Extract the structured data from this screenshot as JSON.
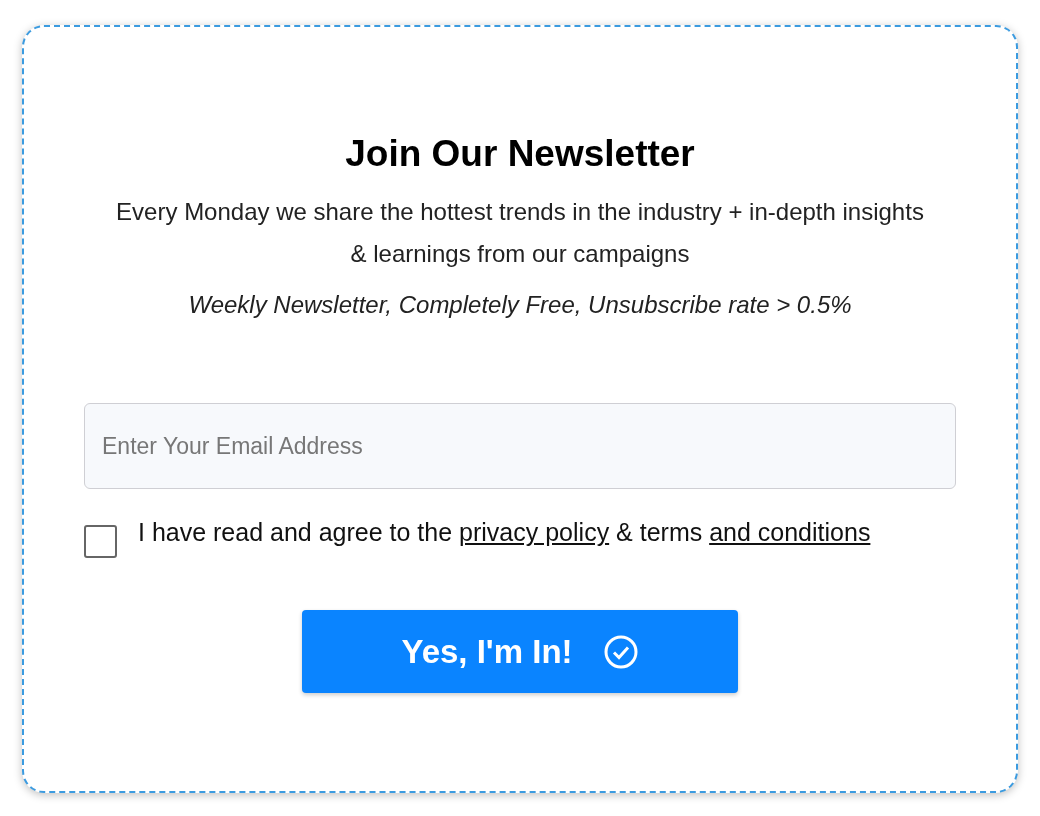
{
  "title": "Join Our Newsletter",
  "description": "Every Monday we share the hottest trends in the industry + in-depth insights & learnings from our campaigns",
  "tagline": "Weekly Newsletter, Completely Free, Unsubscribe rate > 0.5%",
  "email_field": {
    "placeholder": "Enter Your Email Address"
  },
  "consent": {
    "checked": false,
    "parts": [
      {
        "kind": "text",
        "text": "I have read and agree to the "
      },
      {
        "kind": "link",
        "text": "privacy policy"
      },
      {
        "kind": "text",
        "text": " & terms "
      },
      {
        "kind": "link",
        "text": "and conditions"
      }
    ]
  },
  "button": {
    "label": "Yes, I'm In!"
  }
}
